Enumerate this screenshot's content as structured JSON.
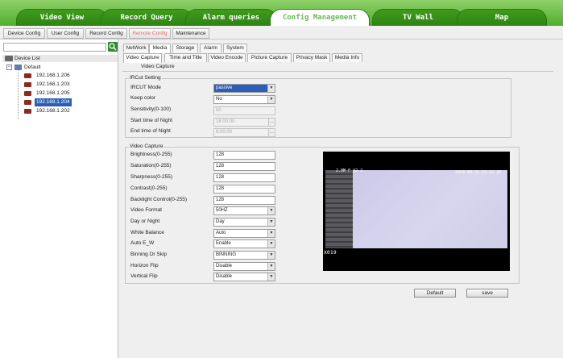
{
  "top_tabs": [
    "Video View",
    "Record Query",
    "Alarm queries",
    "Config Management",
    "TV Wall",
    "Map"
  ],
  "sub_buttons": [
    "Device Config",
    "User Config",
    "Record Config",
    "Remote Config",
    "Maintenance"
  ],
  "device_list": {
    "header": "Device List",
    "group": "Default",
    "devices": [
      "192.168.1.206",
      "192.168.1.203",
      "192.168.1.205",
      "192.168.1.204",
      "192.168.1.202"
    ],
    "selected": "192.168.1.204"
  },
  "tabs_level1": [
    "NetWork",
    "Media",
    "Storage",
    "Alarm",
    "System"
  ],
  "tabs_level2": [
    "Video Capture",
    "Time and Title",
    "Video Encode",
    "Picture Capture",
    "Privacy Mask",
    "Media Info"
  ],
  "section_title": "Video Capture",
  "ircut": {
    "title": "IRCut Setting",
    "mode_label": "IRCUT Mode",
    "mode_value": "passive",
    "keep_color_label": "Keep color",
    "keep_color_value": "No",
    "sensitivity_label": "Sensitivity(0-100)",
    "sensitivity_value": "50",
    "start_label": "Start time of Night",
    "start_value": "18:00:00",
    "end_label": "End time of Night",
    "end_value": "8:00:00"
  },
  "capture": {
    "title": "Video Capture",
    "rows": [
      {
        "label": "Brightness(0-255)",
        "value": "128"
      },
      {
        "label": "Saturation(0-255)",
        "value": "128"
      },
      {
        "label": "Sharpness(0-255)",
        "value": "128"
      },
      {
        "label": "Contrast(0-255)",
        "value": "128"
      },
      {
        "label": "Backlight Control(0-255)",
        "value": "128"
      },
      {
        "label": "Video Format",
        "value": "50HZ"
      },
      {
        "label": "Day or Night",
        "value": "Day"
      },
      {
        "label": "White Balance",
        "value": "Auto"
      },
      {
        "label": "Auto E_W",
        "value": "Enable"
      },
      {
        "label": "Binning Or Skip",
        "value": "BINNING"
      },
      {
        "label": "Horizon Flip",
        "value": "Disable"
      },
      {
        "label": "Vertical Flip",
        "value": "Disable"
      }
    ]
  },
  "video": {
    "overlay_left": "2.0M F X2 2",
    "overlay_right": "2014-08-31 15 12 28",
    "channel": "X019"
  },
  "buttons": {
    "default": "Default",
    "save": "save"
  }
}
